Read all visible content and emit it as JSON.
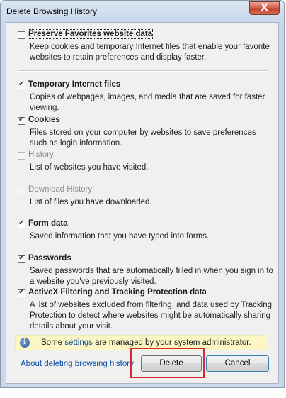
{
  "window": {
    "title": "Delete Browsing History",
    "close_label": "X"
  },
  "options": [
    {
      "id": "preserve-favorites",
      "label": "Preserve Favorites website data",
      "checked": false,
      "enabled": true,
      "focused": true,
      "description": "Keep cookies and temporary Internet files that enable your favorite websites to retain preferences and display faster."
    },
    {
      "id": "temporary-internet-files",
      "label": "Temporary Internet files",
      "checked": true,
      "enabled": true,
      "description": "Copies of webpages, images, and media that are saved for faster viewing."
    },
    {
      "id": "cookies",
      "label": "Cookies",
      "checked": true,
      "enabled": true,
      "description": "Files stored on your computer by websites to save preferences such as login information."
    },
    {
      "id": "history",
      "label": "History",
      "checked": false,
      "enabled": false,
      "description": "List of websites you have visited."
    },
    {
      "id": "download-history",
      "label": "Download History",
      "checked": false,
      "enabled": false,
      "description": "List of files you have downloaded."
    },
    {
      "id": "form-data",
      "label": "Form data",
      "checked": true,
      "enabled": true,
      "description": "Saved information that you have typed into forms."
    },
    {
      "id": "passwords",
      "label": "Passwords",
      "checked": true,
      "enabled": true,
      "description": "Saved passwords that are automatically filled in when you sign in to a website you've previously visited."
    },
    {
      "id": "activex-filtering",
      "label": "ActiveX Filtering and Tracking Protection data",
      "checked": true,
      "enabled": true,
      "description": "A list of websites excluded from filtering, and data used by Tracking Protection to detect where websites might be automatically sharing details about your visit."
    }
  ],
  "info_bar": {
    "icon": "info-icon",
    "text_before": "Some ",
    "link": "settings",
    "text_after": " are managed by your system administrator."
  },
  "footer": {
    "about_link": "About deleting browsing history",
    "delete_label": "Delete",
    "cancel_label": "Cancel"
  },
  "colors": {
    "highlight_border": "#d42a33",
    "link": "#0f4fa8",
    "info_bar_bg": "#fbf6c4"
  }
}
